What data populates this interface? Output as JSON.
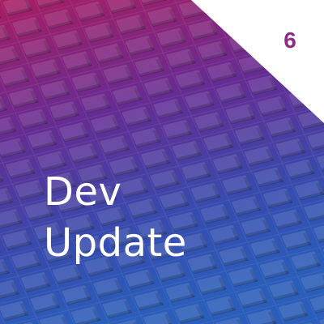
{
  "card": {
    "number": "6",
    "title_lines": [
      "Dev",
      "Update"
    ]
  },
  "colors": {
    "gradient_top": "#b0206a",
    "gradient_mid": "#6a2f9a",
    "gradient_bottom": "#2f5bbf",
    "accent_number": "#8a2b86",
    "title_text": "#ffffff",
    "corner_background": "#ffffff"
  },
  "icons": {
    "background_pattern": "isometric-cubes-pattern"
  }
}
